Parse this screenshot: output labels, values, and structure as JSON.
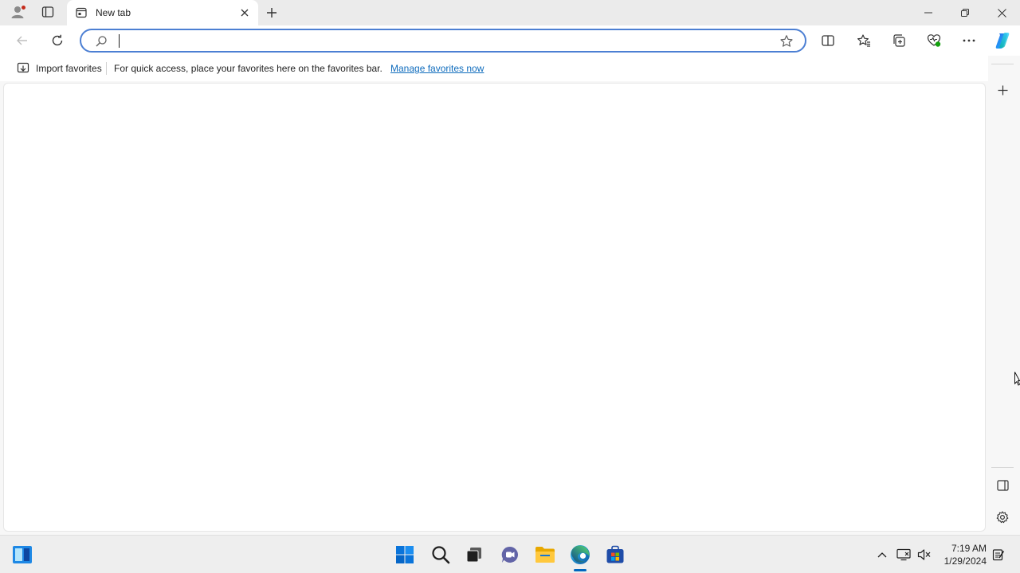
{
  "browser": {
    "tab": {
      "title": "New tab"
    },
    "address_bar": {
      "value": "",
      "placeholder": ""
    },
    "favorites_bar": {
      "import_label": "Import favorites",
      "message": "For quick access, place your favorites here on the favorites bar.",
      "manage_link": "Manage favorites now"
    }
  },
  "taskbar": {
    "clock": {
      "time": "7:19 AM",
      "date": "1/29/2024"
    }
  },
  "colors": {
    "accent": "#0067c0",
    "address_focus_border": "#4c7fd3",
    "link": "#0f6cbd",
    "notification_dot": "#c42b1c"
  },
  "icons": [
    "profile-icon",
    "tab-actions-icon",
    "newtab-page-icon",
    "tab-close-icon",
    "new-tab-icon",
    "minimize-icon",
    "restore-icon",
    "close-window-icon",
    "back-icon",
    "refresh-icon",
    "search-icon",
    "favorite-star-icon",
    "split-screen-icon",
    "favorites-icon",
    "collections-icon",
    "browser-essentials-icon",
    "more-icon",
    "copilot-icon",
    "import-favorites-icon",
    "sidebar-add-icon",
    "hide-sidebar-icon",
    "sidebar-settings-icon",
    "widgets-icon",
    "windows-start-icon",
    "search-taskbar-icon",
    "task-view-icon",
    "teams-chat-icon",
    "file-explorer-icon",
    "edge-icon",
    "store-icon",
    "show-hidden-icons-chevron",
    "network-icon",
    "volume-mute-icon",
    "notifications-icon"
  ]
}
